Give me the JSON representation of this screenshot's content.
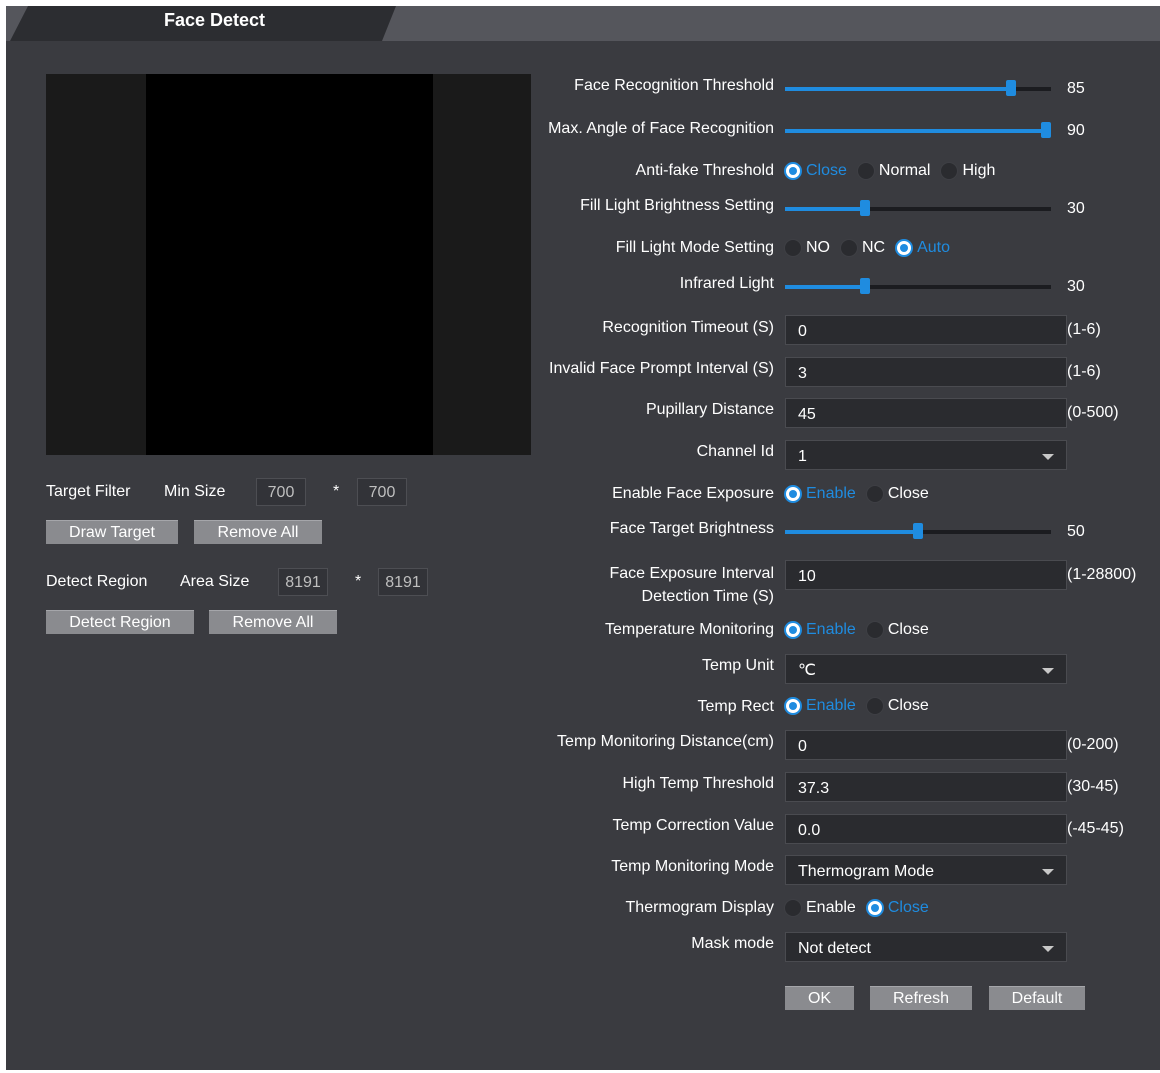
{
  "tab": {
    "title": "Face Detect"
  },
  "left": {
    "target_filter_label": "Target Filter",
    "min_size_label": "Min Size",
    "min_w": "700",
    "min_h": "700",
    "star": "*",
    "draw_target": "Draw Target",
    "remove_all_1": "Remove All",
    "detect_region_label": "Detect Region",
    "area_size_label": "Area Size",
    "area_w": "8191",
    "area_h": "8191",
    "detect_region_btn": "Detect Region",
    "remove_all_2": "Remove All"
  },
  "form": {
    "face_recog_threshold": {
      "label": "Face Recognition Threshold",
      "value": "85",
      "fraction": 0.85
    },
    "max_angle": {
      "label": "Max. Angle of Face Recognition",
      "value": "90",
      "fraction": 1.0
    },
    "anti_fake": {
      "label": "Anti-fake Threshold",
      "options": [
        "Close",
        "Normal",
        "High"
      ],
      "selected": "Close"
    },
    "fill_light_brightness": {
      "label": "Fill Light Brightness Setting",
      "value": "30",
      "fraction": 0.3
    },
    "fill_light_mode": {
      "label": "Fill Light Mode Setting",
      "options": [
        "NO",
        "NC",
        "Auto"
      ],
      "selected": "Auto"
    },
    "infrared_light": {
      "label": "Infrared Light",
      "value": "30",
      "fraction": 0.3
    },
    "recognition_timeout": {
      "label": "Recognition Timeout (S)",
      "value": "0",
      "range": "(1-6)"
    },
    "invalid_face_prompt": {
      "label": "Invalid Face Prompt Interval (S)",
      "value": "3",
      "range": "(1-6)"
    },
    "pupillary_distance": {
      "label": "Pupillary Distance",
      "value": "45",
      "range": "(0-500)"
    },
    "channel_id": {
      "label": "Channel Id",
      "value": "1"
    },
    "enable_face_exposure": {
      "label": "Enable Face Exposure",
      "options": [
        "Enable",
        "Close"
      ],
      "selected": "Enable"
    },
    "face_target_brightness": {
      "label": "Face Target Brightness",
      "value": "50",
      "fraction": 0.5
    },
    "face_exposure_interval": {
      "label_line1": "Face Exposure Interval",
      "label_line2": "Detection Time (S)",
      "value": "10",
      "range": "(1-28800)"
    },
    "temp_monitoring": {
      "label": "Temperature Monitoring",
      "options": [
        "Enable",
        "Close"
      ],
      "selected": "Enable"
    },
    "temp_unit": {
      "label": "Temp Unit",
      "value": "℃"
    },
    "temp_rect": {
      "label": "Temp Rect",
      "options": [
        "Enable",
        "Close"
      ],
      "selected": "Enable"
    },
    "temp_monitoring_distance": {
      "label": "Temp Monitoring Distance(cm)",
      "value": "0",
      "range": "(0-200)"
    },
    "high_temp_threshold": {
      "label": "High Temp Threshold",
      "value": "37.3",
      "range": "(30-45)"
    },
    "temp_correction": {
      "label": "Temp Correction Value",
      "value": "0.0",
      "range": "(-45-45)"
    },
    "temp_monitoring_mode": {
      "label": "Temp Monitoring Mode",
      "value": "Thermogram Mode"
    },
    "thermogram_display": {
      "label": "Thermogram Display",
      "options": [
        "Enable",
        "Close"
      ],
      "selected": "Close"
    },
    "mask_mode": {
      "label": "Mask mode",
      "value": "Not detect"
    }
  },
  "buttons": {
    "ok": "OK",
    "refresh": "Refresh",
    "default": "Default"
  },
  "colors": {
    "accent": "#1f8ce0",
    "panel": "#3a3b40",
    "tab_active": "#2c2d31"
  }
}
